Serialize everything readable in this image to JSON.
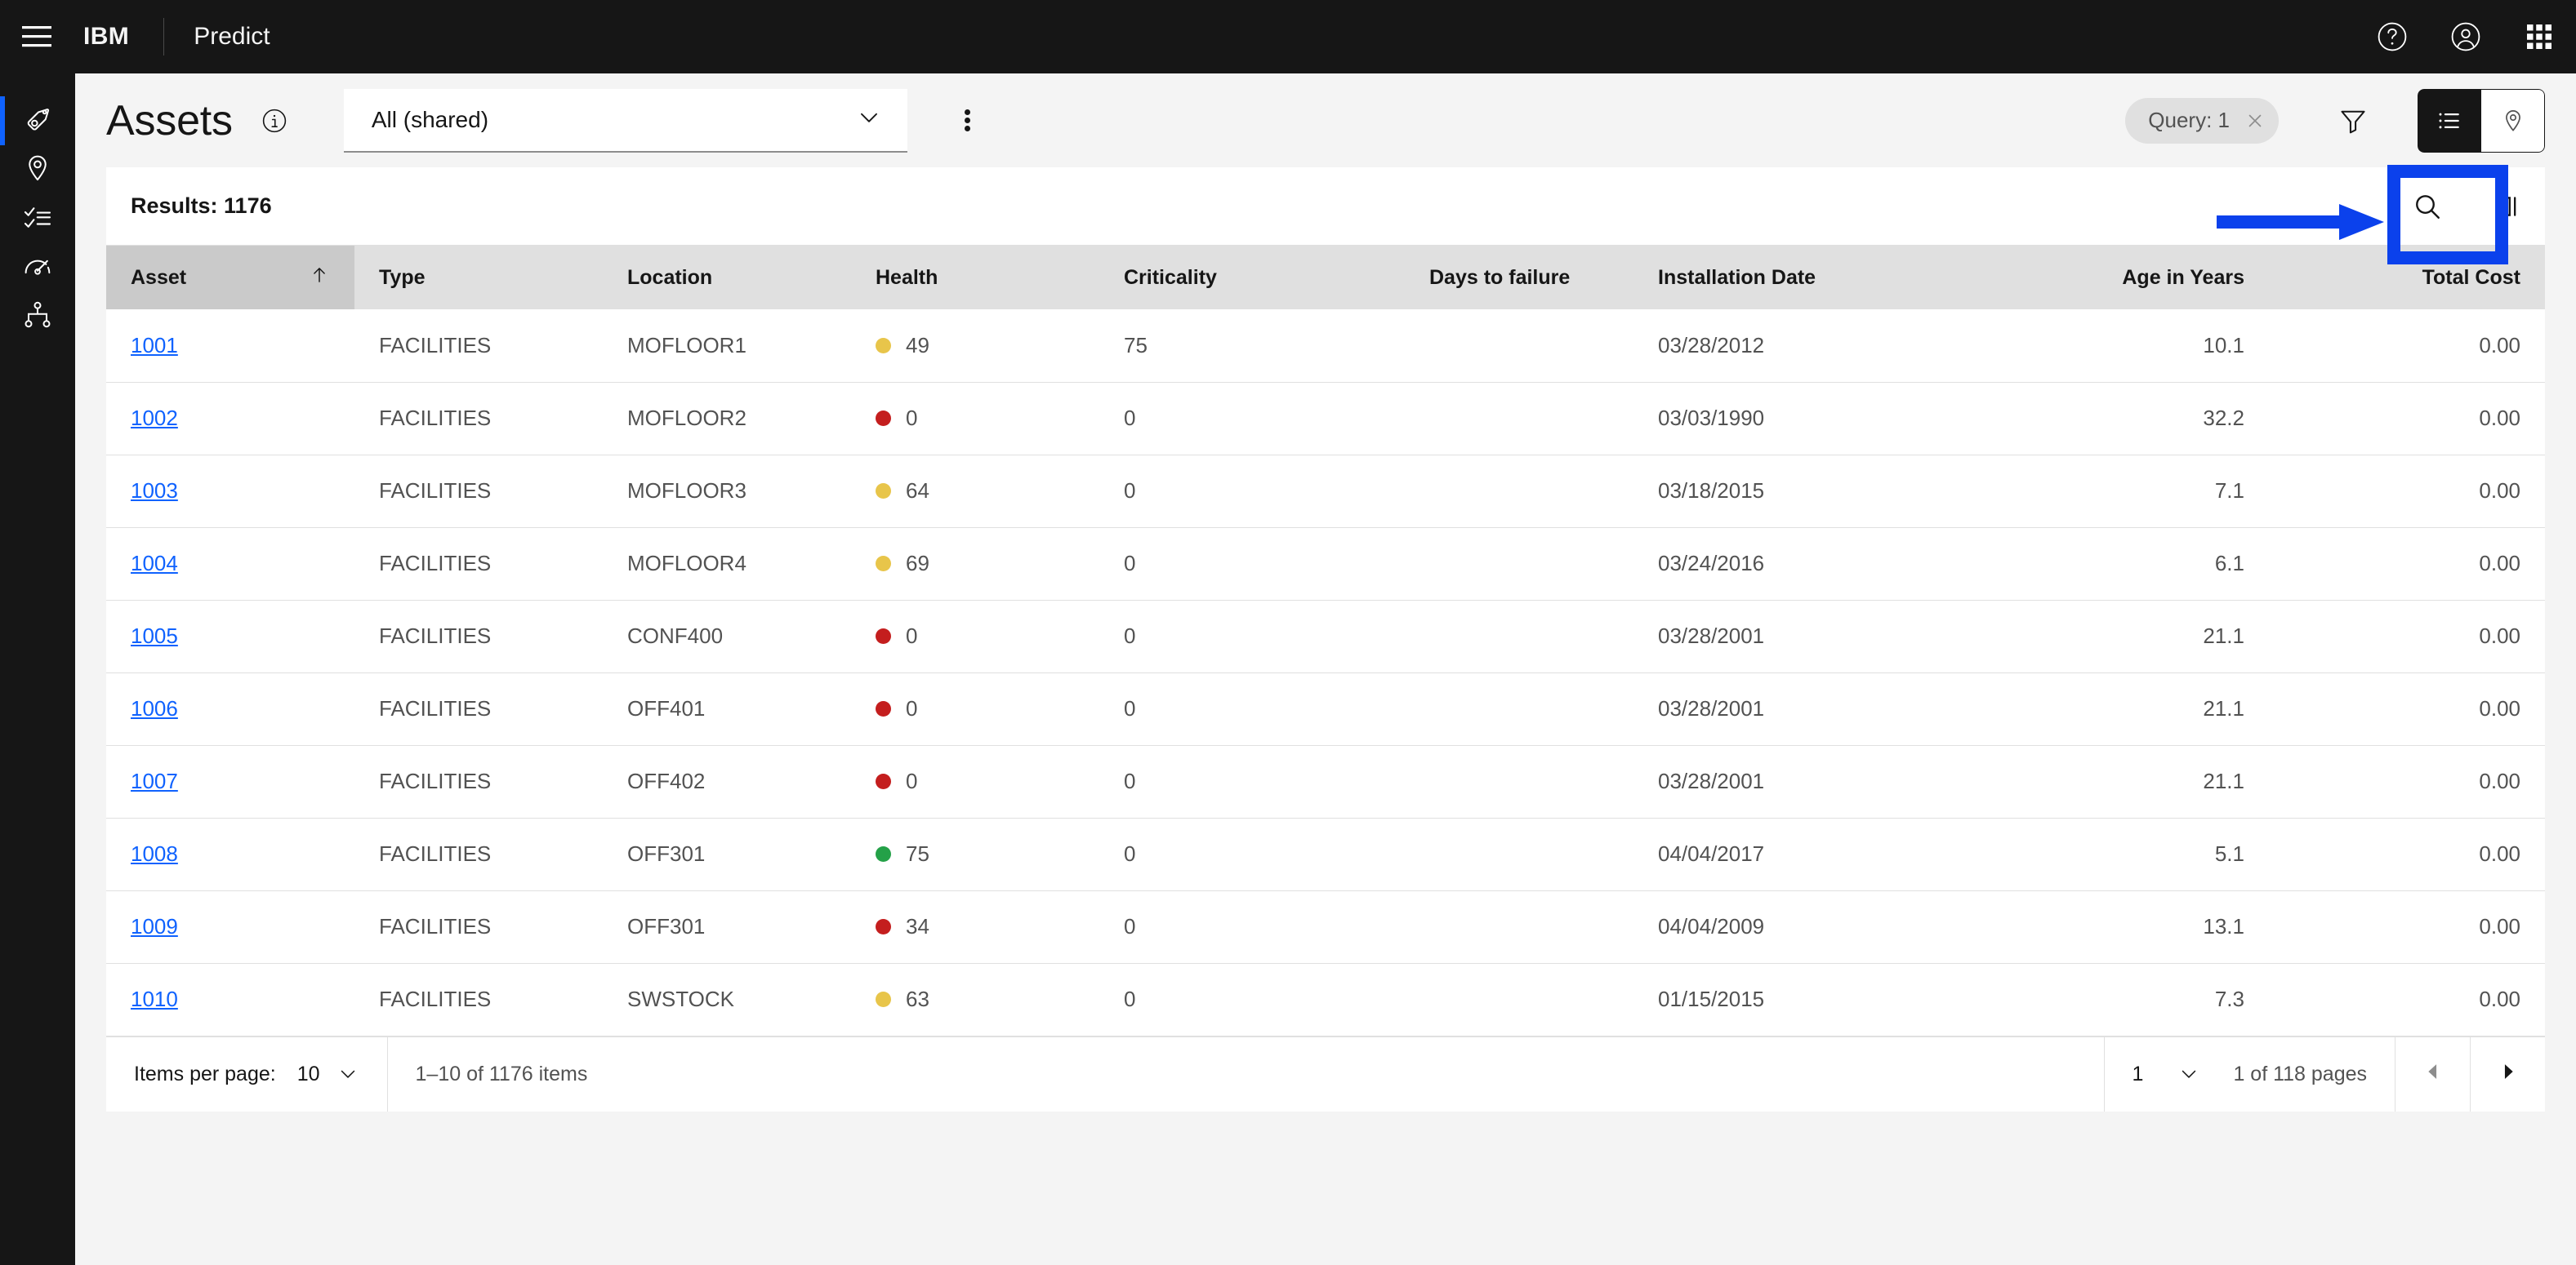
{
  "header": {
    "menu_icon": "hamburger-menu-icon",
    "brand": "IBM",
    "app_name": "Predict",
    "help_icon": "help-circle-icon",
    "account_icon": "user-avatar-icon",
    "switcher_icon": "app-switcher-icon"
  },
  "sidebar": {
    "items": [
      {
        "icon": "asset-tag-icon",
        "name": "assets",
        "active": true
      },
      {
        "icon": "location-pin-icon",
        "name": "locations",
        "active": false
      },
      {
        "icon": "checklist-icon",
        "name": "work-orders",
        "active": false
      },
      {
        "icon": "gauge-meter-icon",
        "name": "meters",
        "active": false
      },
      {
        "icon": "hierarchy-icon",
        "name": "hierarchy",
        "active": false
      }
    ]
  },
  "page": {
    "title": "Assets",
    "info_icon": "info-circle-icon",
    "view_select": {
      "value": "All (shared)",
      "chevron_icon": "chevron-down-icon"
    },
    "overflow_icon": "overflow-vertical-icon",
    "query_chip": {
      "label": "Query: 1",
      "close_icon": "close-x-icon"
    },
    "filter_icon": "filter-funnel-icon",
    "view_toggle": {
      "list_icon": "list-view-icon",
      "map_icon": "map-pin-view-icon",
      "selected": "list"
    }
  },
  "toolbar": {
    "results_label": "Results: 1176",
    "search_icon": "search-magnifier-icon",
    "columns_icon": "column-settings-icon"
  },
  "table": {
    "columns": [
      {
        "label": "Asset",
        "align": "left",
        "sorted": true,
        "sort_icon": "sort-arrow-up-icon"
      },
      {
        "label": "Type",
        "align": "left",
        "sorted": false
      },
      {
        "label": "Location",
        "align": "left",
        "sorted": false
      },
      {
        "label": "Health",
        "align": "left",
        "sorted": false
      },
      {
        "label": "Criticality",
        "align": "left",
        "sorted": false
      },
      {
        "label": "Days to failure",
        "align": "left",
        "sorted": false
      },
      {
        "label": "Installation Date",
        "align": "left",
        "sorted": false
      },
      {
        "label": "Age in Years",
        "align": "right",
        "sorted": false
      },
      {
        "label": "Total Cost",
        "align": "right",
        "sorted": false
      }
    ],
    "rows": [
      {
        "asset": "1001",
        "type": "FACILITIES",
        "location": "MOFLOOR1",
        "health": "49",
        "health_color": "#e8c54a",
        "criticality": "75",
        "days_to_failure": "",
        "installation_date": "03/28/2012",
        "age_in_years": "10.1",
        "total_cost": "0.00"
      },
      {
        "asset": "1002",
        "type": "FACILITIES",
        "location": "MOFLOOR2",
        "health": "0",
        "health_color": "#c41e1e",
        "criticality": "0",
        "days_to_failure": "",
        "installation_date": "03/03/1990",
        "age_in_years": "32.2",
        "total_cost": "0.00"
      },
      {
        "asset": "1003",
        "type": "FACILITIES",
        "location": "MOFLOOR3",
        "health": "64",
        "health_color": "#e8c54a",
        "criticality": "0",
        "days_to_failure": "",
        "installation_date": "03/18/2015",
        "age_in_years": "7.1",
        "total_cost": "0.00"
      },
      {
        "asset": "1004",
        "type": "FACILITIES",
        "location": "MOFLOOR4",
        "health": "69",
        "health_color": "#e8c54a",
        "criticality": "0",
        "days_to_failure": "",
        "installation_date": "03/24/2016",
        "age_in_years": "6.1",
        "total_cost": "0.00"
      },
      {
        "asset": "1005",
        "type": "FACILITIES",
        "location": "CONF400",
        "health": "0",
        "health_color": "#c41e1e",
        "criticality": "0",
        "days_to_failure": "",
        "installation_date": "03/28/2001",
        "age_in_years": "21.1",
        "total_cost": "0.00"
      },
      {
        "asset": "1006",
        "type": "FACILITIES",
        "location": "OFF401",
        "health": "0",
        "health_color": "#c41e1e",
        "criticality": "0",
        "days_to_failure": "",
        "installation_date": "03/28/2001",
        "age_in_years": "21.1",
        "total_cost": "0.00"
      },
      {
        "asset": "1007",
        "type": "FACILITIES",
        "location": "OFF402",
        "health": "0",
        "health_color": "#c41e1e",
        "criticality": "0",
        "days_to_failure": "",
        "installation_date": "03/28/2001",
        "age_in_years": "21.1",
        "total_cost": "0.00"
      },
      {
        "asset": "1008",
        "type": "FACILITIES",
        "location": "OFF301",
        "health": "75",
        "health_color": "#24a148",
        "criticality": "0",
        "days_to_failure": "",
        "installation_date": "04/04/2017",
        "age_in_years": "5.1",
        "total_cost": "0.00"
      },
      {
        "asset": "1009",
        "type": "FACILITIES",
        "location": "OFF301",
        "health": "34",
        "health_color": "#c41e1e",
        "criticality": "0",
        "days_to_failure": "",
        "installation_date": "04/04/2009",
        "age_in_years": "13.1",
        "total_cost": "0.00"
      },
      {
        "asset": "1010",
        "type": "FACILITIES",
        "location": "SWSTOCK",
        "health": "63",
        "health_color": "#e8c54a",
        "criticality": "0",
        "days_to_failure": "",
        "installation_date": "01/15/2015",
        "age_in_years": "7.3",
        "total_cost": "0.00"
      }
    ]
  },
  "pagination": {
    "items_per_page_label": "Items per page:",
    "items_per_page_value": "10",
    "range_text": "1–10 of 1176 items",
    "page_value": "1",
    "page_of_text": "1 of 118 pages",
    "prev_icon": "caret-left-icon",
    "next_icon": "caret-right-icon",
    "chevron_icon": "chevron-down-icon"
  },
  "annotation": {
    "color": "#0b41ec",
    "arrow_name": "annotation-arrow",
    "box_name": "annotation-highlight-box"
  }
}
